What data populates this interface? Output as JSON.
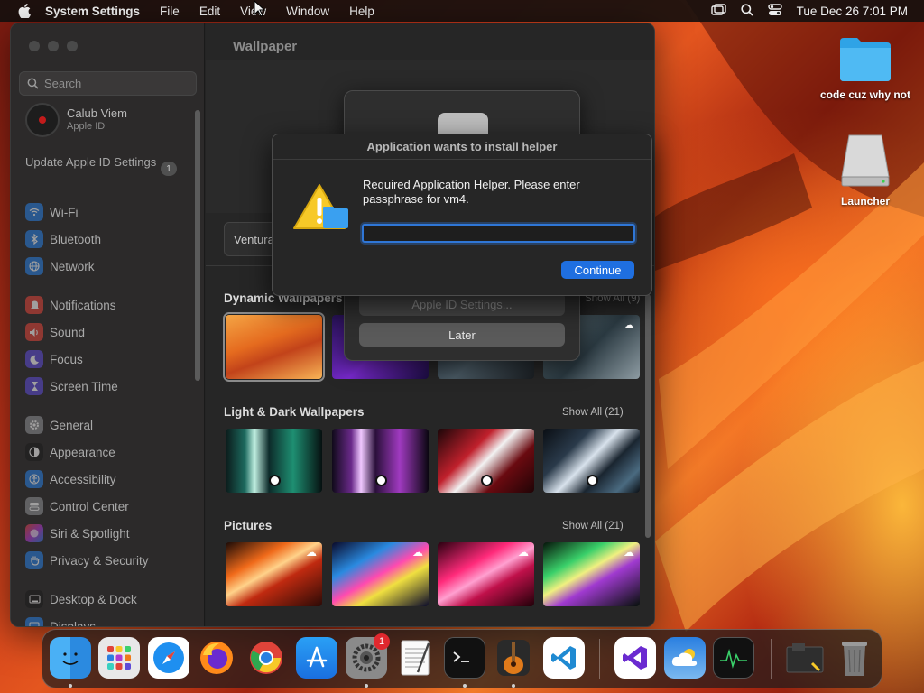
{
  "menubar": {
    "app_name": "System Settings",
    "menus": [
      "File",
      "Edit",
      "View",
      "Window",
      "Help"
    ],
    "clock": "Tue Dec 26  7:01 PM"
  },
  "desktop": {
    "icons": [
      {
        "label": "code cuz why not",
        "icon": "folder-icon"
      },
      {
        "label": "Launcher",
        "icon": "drive-icon"
      }
    ]
  },
  "sidebar": {
    "search_placeholder": "Search",
    "account": {
      "name": "Calub Viem",
      "subtitle": "Apple ID"
    },
    "update": {
      "label": "Update Apple ID Settings",
      "badge": "1"
    },
    "items": [
      {
        "label": "Wi-Fi",
        "icon": "wifi-icon",
        "color": "#2a7fe0"
      },
      {
        "label": "Bluetooth",
        "icon": "bluetooth-icon",
        "color": "#2a7fe0"
      },
      {
        "label": "Network",
        "icon": "globe-icon",
        "color": "#2a7fe0"
      },
      {
        "label": "Notifications",
        "icon": "bell-icon",
        "color": "#e0443a"
      },
      {
        "label": "Sound",
        "icon": "speaker-icon",
        "color": "#e0443a"
      },
      {
        "label": "Focus",
        "icon": "moon-icon",
        "color": "#5e4bd6"
      },
      {
        "label": "Screen Time",
        "icon": "hourglass-icon",
        "color": "#5e4bd6"
      },
      {
        "label": "General",
        "icon": "gear-icon",
        "color": "#8e8e93"
      },
      {
        "label": "Appearance",
        "icon": "appearance-icon",
        "color": "#1c1c1c"
      },
      {
        "label": "Accessibility",
        "icon": "accessibility-icon",
        "color": "#2a7fe0"
      },
      {
        "label": "Control Center",
        "icon": "control-center-icon",
        "color": "#8e8e93"
      },
      {
        "label": "Siri & Spotlight",
        "icon": "siri-icon",
        "color": "#b03ad0"
      },
      {
        "label": "Privacy & Security",
        "icon": "hand-icon",
        "color": "#2a7fe0"
      },
      {
        "label": "Desktop & Dock",
        "icon": "dock-icon",
        "color": "#1c1c1c"
      },
      {
        "label": "Displays",
        "icon": "display-icon",
        "color": "#2a7fe0"
      }
    ]
  },
  "main": {
    "title": "Wallpaper",
    "current_wallpaper": "Ventura",
    "sections": [
      {
        "title": "Dynamic Wallpapers",
        "show_all": "Show All (9)"
      },
      {
        "title": "Light & Dark Wallpapers",
        "show_all": "Show All (21)"
      },
      {
        "title": "Pictures",
        "show_all": "Show All (21)"
      }
    ]
  },
  "sheet": {
    "apple_id_button": "Apple ID Settings...",
    "later_button": "Later"
  },
  "dialog": {
    "title": "Application wants to install helper",
    "message": "Required Application Helper. Please enter passphrase for vm4.",
    "password_value": "",
    "continue_button": "Continue"
  },
  "dock": {
    "apps": [
      "Finder",
      "Launchpad",
      "Safari",
      "Firefox",
      "Chrome",
      "App Store",
      "System Settings",
      "TextEdit",
      "Terminal",
      "GarageBand",
      "Visual Studio Code",
      "Visual Studio",
      "Weather",
      "Activity Monitor",
      "Downloads",
      "Trash"
    ],
    "system_settings_badge": "1"
  }
}
